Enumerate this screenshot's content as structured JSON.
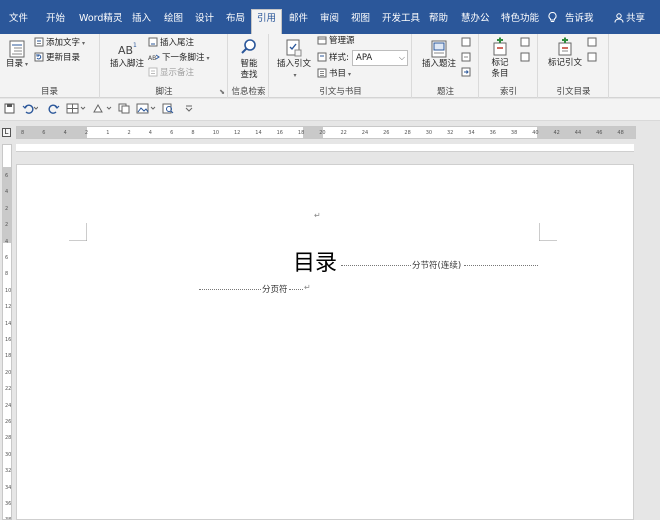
{
  "tabs": [
    {
      "label": "文件"
    },
    {
      "label": "开始"
    },
    {
      "label": "Word精灵"
    },
    {
      "label": "插入"
    },
    {
      "label": "绘图"
    },
    {
      "label": "设计"
    },
    {
      "label": "布局"
    },
    {
      "label": "引用"
    },
    {
      "label": "邮件"
    },
    {
      "label": "审阅"
    },
    {
      "label": "视图"
    },
    {
      "label": "开发工具"
    },
    {
      "label": "帮助"
    },
    {
      "label": "慧办公"
    },
    {
      "label": "特色功能"
    }
  ],
  "tell_me": "告诉我",
  "share": "共享",
  "ribbon": {
    "toc_group": {
      "label": "目录",
      "toc_button": "目录",
      "add_text": "添加文字",
      "update_toc": "更新目录"
    },
    "footnote_group": {
      "label": "脚注",
      "insert_footnote": "插入脚注",
      "insert_endnote": "插入尾注",
      "next_footnote": "下一条脚注",
      "show_notes": "显示备注",
      "footnote_superscript": "AB",
      "next_footnote_glyph": "AB"
    },
    "research_group": {
      "label": "信息检索",
      "smart_lookup_line1": "智能",
      "smart_lookup_line2": "查找"
    },
    "citation_group": {
      "label": "引文与书目",
      "insert_citation": "插入引文",
      "manage_sources": "管理源",
      "style_label": "样式:",
      "style_value": "APA",
      "bibliography": "书目"
    },
    "caption_group": {
      "label": "题注",
      "insert_caption": "插入题注"
    },
    "index_group": {
      "label": "索引",
      "mark_entry_line1": "标记",
      "mark_entry_line2": "条目"
    },
    "toa_group": {
      "label": "引文目录",
      "mark_citation": "标记引文"
    }
  },
  "ruler": {
    "corner_glyph": "L",
    "h_ticks": [
      "8",
      "6",
      "4",
      "2",
      "1",
      "2",
      "4",
      "6",
      "8",
      "10",
      "12",
      "14",
      "16",
      "18",
      "20",
      "22",
      "24",
      "26",
      "28",
      "30",
      "32",
      "34",
      "36",
      "38",
      "40",
      "42",
      "44",
      "46",
      "48"
    ],
    "v_ticks": [
      "6",
      "4",
      "2",
      "2",
      "4",
      "6",
      "8",
      "10",
      "12",
      "14",
      "16",
      "18",
      "20",
      "22",
      "24",
      "26",
      "28",
      "30",
      "32",
      "34",
      "36",
      "38"
    ]
  },
  "document": {
    "para_mark": "↵",
    "title": "目录",
    "section_break_label": "分节符(连续)",
    "page_break_label": "分页符"
  }
}
